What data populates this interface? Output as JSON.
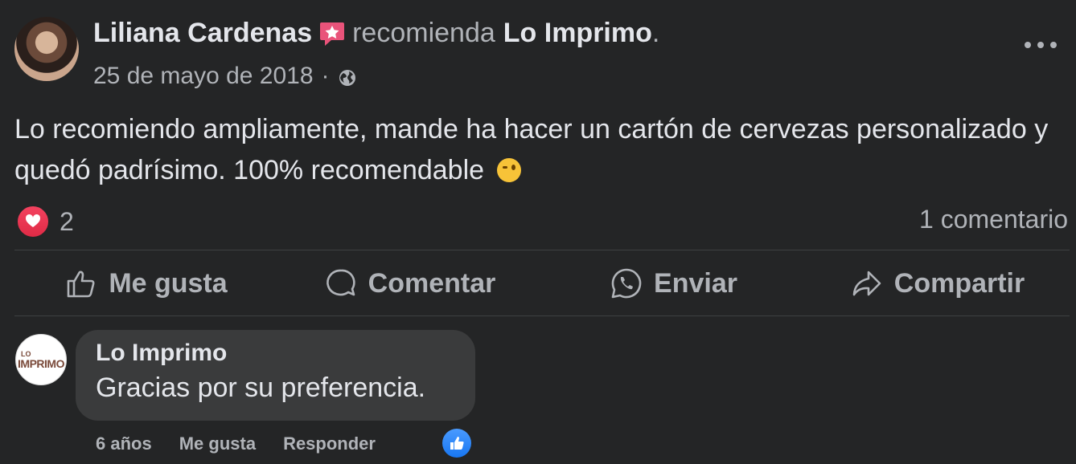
{
  "post": {
    "author": "Liliana Cardenas",
    "recommends_text": "recomienda",
    "page_name": "Lo Imprimo",
    "period": ".",
    "date": "25 de mayo de 2018",
    "separator": "·",
    "text": "Lo recomiendo ampliamente, mande ha hacer un cartón de cervezas personalizado y quedó padrísimo. 100% recomendable",
    "reaction_count": "2",
    "comment_count": "1 comentario"
  },
  "actions": {
    "like": "Me gusta",
    "comment": "Comentar",
    "send": "Enviar",
    "share": "Compartir"
  },
  "comment": {
    "logo_small": "LO",
    "logo_main": "IMPRIMO",
    "author": "Lo Imprimo",
    "text": "Gracias por su preferencia.",
    "time": "6 años",
    "like": "Me gusta",
    "reply": "Responder"
  },
  "icons": {
    "recommend": "recommend-star-icon",
    "privacy": "globe-icon",
    "more": "more-options-icon",
    "heart": "love-reaction-icon",
    "like_action": "thumbs-up-icon",
    "comment_action": "comment-bubble-icon",
    "send_action": "whatsapp-icon",
    "share_action": "share-arrow-icon",
    "comment_reaction": "like-reaction-icon"
  },
  "colors": {
    "background": "#242526",
    "bubble": "#3a3b3c",
    "primary_text": "#e4e6eb",
    "secondary_text": "#b0b3b8",
    "recommend_badge": "#e9537a",
    "love": "#f3425f",
    "like": "#1877f2"
  }
}
